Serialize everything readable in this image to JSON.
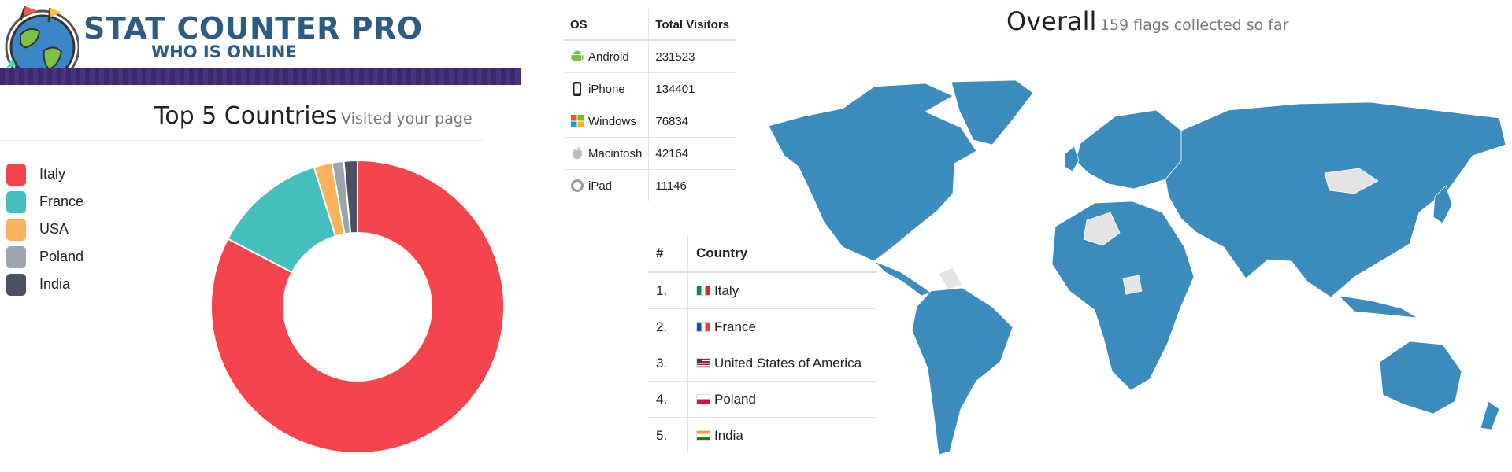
{
  "header": {
    "logo_title": "STAT COUNTER PRO",
    "logo_subtitle": "WHO IS ONLINE"
  },
  "top_countries": {
    "title": "Top 5 Countries",
    "subtitle": "Visited your page",
    "legend": [
      {
        "label": "Italy",
        "color": "#f5444b"
      },
      {
        "label": "France",
        "color": "#45bfbb"
      },
      {
        "label": "USA",
        "color": "#fbb25a"
      },
      {
        "label": "Poland",
        "color": "#9da4b1"
      },
      {
        "label": "India",
        "color": "#4a5160"
      }
    ]
  },
  "chart_data": {
    "type": "pie",
    "hole": true,
    "categories": [
      "Italy",
      "France",
      "USA",
      "Poland",
      "India"
    ],
    "values": [
      82.7,
      12.5,
      2.0,
      1.3,
      1.5
    ],
    "colors": [
      "#f5444b",
      "#45bfbb",
      "#fbb25a",
      "#9da4b1",
      "#4a5160"
    ],
    "title": "Top 5 Countries",
    "subtitle": "Visited your page",
    "legend_position": "left"
  },
  "os_table": {
    "headers": [
      "OS",
      "Total Visitors"
    ],
    "rows": [
      {
        "os": "Android",
        "icon": "android-icon",
        "visitors": "231523"
      },
      {
        "os": "iPhone",
        "icon": "iphone-icon",
        "visitors": "134401"
      },
      {
        "os": "Windows",
        "icon": "windows-icon",
        "visitors": "76834"
      },
      {
        "os": "Macintosh",
        "icon": "apple-icon",
        "visitors": "42164"
      },
      {
        "os": "iPad",
        "icon": "ipad-icon",
        "visitors": "11146"
      }
    ]
  },
  "country_table": {
    "headers": [
      "#",
      "Country"
    ],
    "rows": [
      {
        "rank": "1.",
        "country": "Italy",
        "flag": "italy-flag"
      },
      {
        "rank": "2.",
        "country": "France",
        "flag": "france-flag"
      },
      {
        "rank": "3.",
        "country": "United States of America",
        "flag": "usa-flag"
      },
      {
        "rank": "4.",
        "country": "Poland",
        "flag": "poland-flag"
      },
      {
        "rank": "5.",
        "country": "India",
        "flag": "india-flag"
      }
    ]
  },
  "overall": {
    "title": "Overall",
    "subtitle": "159 flags collected so far",
    "map_color": "#3b8bbd",
    "uncollected_color": "#e4e4e4"
  }
}
